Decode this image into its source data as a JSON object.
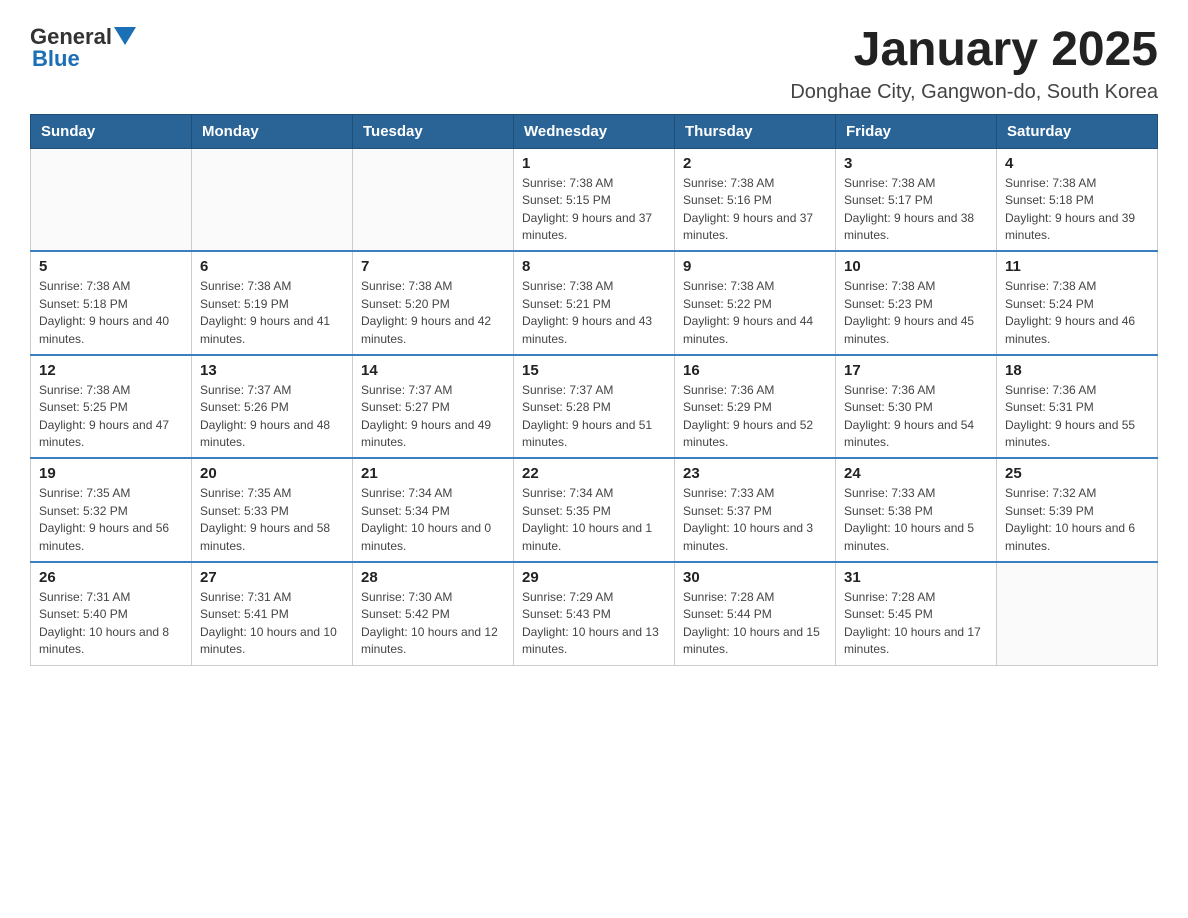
{
  "logo": {
    "general": "General",
    "blue": "Blue"
  },
  "header": {
    "month": "January 2025",
    "location": "Donghae City, Gangwon-do, South Korea"
  },
  "days_of_week": [
    "Sunday",
    "Monday",
    "Tuesday",
    "Wednesday",
    "Thursday",
    "Friday",
    "Saturday"
  ],
  "weeks": [
    [
      {
        "day": "",
        "info": ""
      },
      {
        "day": "",
        "info": ""
      },
      {
        "day": "",
        "info": ""
      },
      {
        "day": "1",
        "info": "Sunrise: 7:38 AM\nSunset: 5:15 PM\nDaylight: 9 hours and 37 minutes."
      },
      {
        "day": "2",
        "info": "Sunrise: 7:38 AM\nSunset: 5:16 PM\nDaylight: 9 hours and 37 minutes."
      },
      {
        "day": "3",
        "info": "Sunrise: 7:38 AM\nSunset: 5:17 PM\nDaylight: 9 hours and 38 minutes."
      },
      {
        "day": "4",
        "info": "Sunrise: 7:38 AM\nSunset: 5:18 PM\nDaylight: 9 hours and 39 minutes."
      }
    ],
    [
      {
        "day": "5",
        "info": "Sunrise: 7:38 AM\nSunset: 5:18 PM\nDaylight: 9 hours and 40 minutes."
      },
      {
        "day": "6",
        "info": "Sunrise: 7:38 AM\nSunset: 5:19 PM\nDaylight: 9 hours and 41 minutes."
      },
      {
        "day": "7",
        "info": "Sunrise: 7:38 AM\nSunset: 5:20 PM\nDaylight: 9 hours and 42 minutes."
      },
      {
        "day": "8",
        "info": "Sunrise: 7:38 AM\nSunset: 5:21 PM\nDaylight: 9 hours and 43 minutes."
      },
      {
        "day": "9",
        "info": "Sunrise: 7:38 AM\nSunset: 5:22 PM\nDaylight: 9 hours and 44 minutes."
      },
      {
        "day": "10",
        "info": "Sunrise: 7:38 AM\nSunset: 5:23 PM\nDaylight: 9 hours and 45 minutes."
      },
      {
        "day": "11",
        "info": "Sunrise: 7:38 AM\nSunset: 5:24 PM\nDaylight: 9 hours and 46 minutes."
      }
    ],
    [
      {
        "day": "12",
        "info": "Sunrise: 7:38 AM\nSunset: 5:25 PM\nDaylight: 9 hours and 47 minutes."
      },
      {
        "day": "13",
        "info": "Sunrise: 7:37 AM\nSunset: 5:26 PM\nDaylight: 9 hours and 48 minutes."
      },
      {
        "day": "14",
        "info": "Sunrise: 7:37 AM\nSunset: 5:27 PM\nDaylight: 9 hours and 49 minutes."
      },
      {
        "day": "15",
        "info": "Sunrise: 7:37 AM\nSunset: 5:28 PM\nDaylight: 9 hours and 51 minutes."
      },
      {
        "day": "16",
        "info": "Sunrise: 7:36 AM\nSunset: 5:29 PM\nDaylight: 9 hours and 52 minutes."
      },
      {
        "day": "17",
        "info": "Sunrise: 7:36 AM\nSunset: 5:30 PM\nDaylight: 9 hours and 54 minutes."
      },
      {
        "day": "18",
        "info": "Sunrise: 7:36 AM\nSunset: 5:31 PM\nDaylight: 9 hours and 55 minutes."
      }
    ],
    [
      {
        "day": "19",
        "info": "Sunrise: 7:35 AM\nSunset: 5:32 PM\nDaylight: 9 hours and 56 minutes."
      },
      {
        "day": "20",
        "info": "Sunrise: 7:35 AM\nSunset: 5:33 PM\nDaylight: 9 hours and 58 minutes."
      },
      {
        "day": "21",
        "info": "Sunrise: 7:34 AM\nSunset: 5:34 PM\nDaylight: 10 hours and 0 minutes."
      },
      {
        "day": "22",
        "info": "Sunrise: 7:34 AM\nSunset: 5:35 PM\nDaylight: 10 hours and 1 minute."
      },
      {
        "day": "23",
        "info": "Sunrise: 7:33 AM\nSunset: 5:37 PM\nDaylight: 10 hours and 3 minutes."
      },
      {
        "day": "24",
        "info": "Sunrise: 7:33 AM\nSunset: 5:38 PM\nDaylight: 10 hours and 5 minutes."
      },
      {
        "day": "25",
        "info": "Sunrise: 7:32 AM\nSunset: 5:39 PM\nDaylight: 10 hours and 6 minutes."
      }
    ],
    [
      {
        "day": "26",
        "info": "Sunrise: 7:31 AM\nSunset: 5:40 PM\nDaylight: 10 hours and 8 minutes."
      },
      {
        "day": "27",
        "info": "Sunrise: 7:31 AM\nSunset: 5:41 PM\nDaylight: 10 hours and 10 minutes."
      },
      {
        "day": "28",
        "info": "Sunrise: 7:30 AM\nSunset: 5:42 PM\nDaylight: 10 hours and 12 minutes."
      },
      {
        "day": "29",
        "info": "Sunrise: 7:29 AM\nSunset: 5:43 PM\nDaylight: 10 hours and 13 minutes."
      },
      {
        "day": "30",
        "info": "Sunrise: 7:28 AM\nSunset: 5:44 PM\nDaylight: 10 hours and 15 minutes."
      },
      {
        "day": "31",
        "info": "Sunrise: 7:28 AM\nSunset: 5:45 PM\nDaylight: 10 hours and 17 minutes."
      },
      {
        "day": "",
        "info": ""
      }
    ]
  ]
}
